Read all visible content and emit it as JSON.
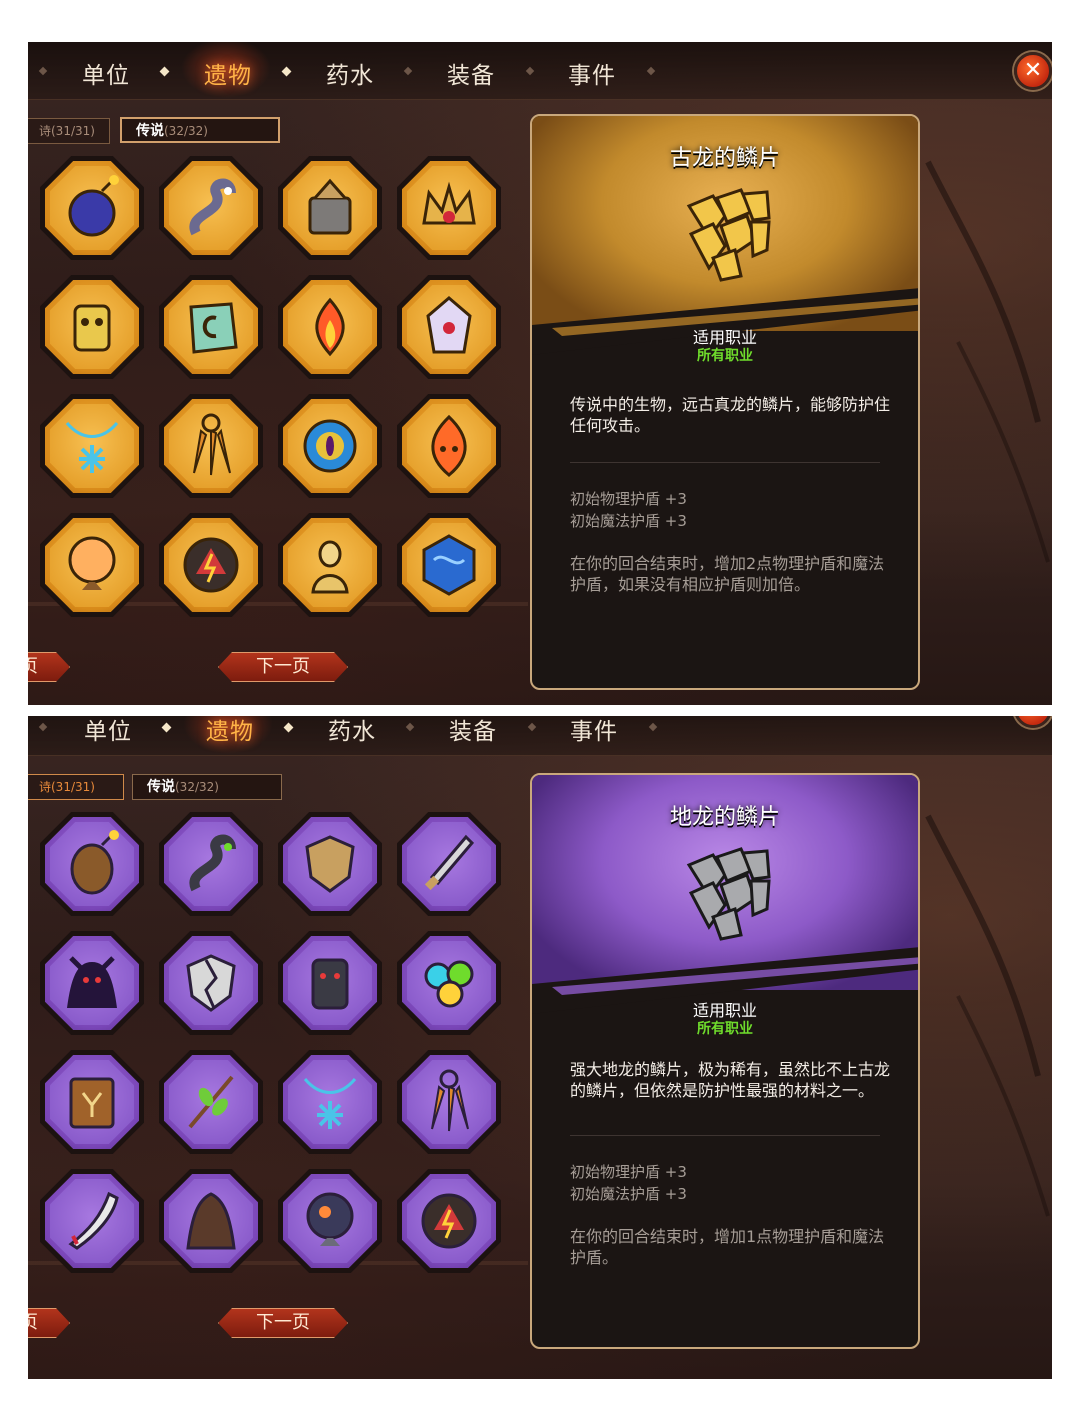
{
  "tabs": [
    "单位",
    "遗物",
    "药水",
    "装备",
    "事件"
  ],
  "active_tab": "遗物",
  "close_icon": "close-icon",
  "screens": [
    {
      "rarity_prev": {
        "label": "",
        "count": "诗(31/31)"
      },
      "rarity_cur": {
        "label": "传说",
        "count": "(32/32)"
      },
      "relics": [
        "bomb-icon",
        "snake-icon",
        "armor-pile-icon",
        "crown-icon",
        "golden-idol-icon",
        "rune-stone-icon",
        "fire-icon",
        "crystal-icon",
        "snowflake-necklace-icon",
        "feather-charm-icon",
        "vortex-eye-icon",
        "fire-spirit-icon",
        "orb-icon",
        "rune-disk-icon",
        "goddess-statue-icon",
        "blue-die-icon"
      ],
      "prev_page_label": "页",
      "next_page_label": "下一页",
      "card": {
        "title": "古龙的鳞片",
        "subhead": "适用职业",
        "classes": "所有职业",
        "description": "传说中的生物，远古真龙的鳞片，能够防护住任何攻击。",
        "stat1": "初始物理护盾 +3",
        "stat2": "初始魔法护盾 +3",
        "effect": "在你的回合结束时，增加2点物理护盾和魔法护盾，如果没有相应护盾则加倍。",
        "art_icon": "golden-scales-icon",
        "theme_color": "#e0a63a"
      }
    },
    {
      "rarity_prev": {
        "label": "",
        "count": "诗(31/31)"
      },
      "rarity_cur": {
        "label": "传说",
        "count": "(32/32)"
      },
      "relics": [
        "barrel-bomb-icon",
        "dark-snake-icon",
        "shield-icon",
        "dagger-icon",
        "shadow-demon-icon",
        "broken-shield-icon",
        "dark-idol-icon",
        "gems-icon",
        "spellbook-icon",
        "branch-icon",
        "snowflake-necklace-icon",
        "feather-charm-icon",
        "blade-icon",
        "cloak-icon",
        "planet-orb-icon",
        "rune-disk-icon"
      ],
      "prev_page_label": "页",
      "next_page_label": "下一页",
      "card": {
        "title": "地龙的鳞片",
        "subhead": "适用职业",
        "classes": "所有职业",
        "description": "强大地龙的鳞片，极为稀有，虽然比不上古龙的鳞片，但依然是防护性最强的材料之一。",
        "stat1": "初始物理护盾 +3",
        "stat2": "初始魔法护盾 +3",
        "effect": "在你的回合结束时，增加1点物理护盾和魔法护盾。",
        "art_icon": "gray-scales-icon",
        "theme_color": "#8d5ac8"
      }
    }
  ]
}
